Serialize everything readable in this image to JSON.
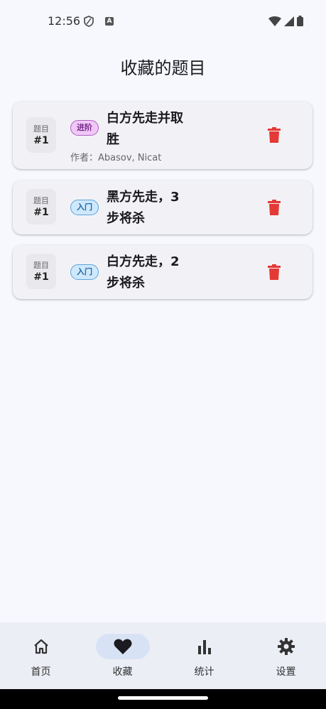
{
  "status": {
    "time": "12:56",
    "a_glyph": "A"
  },
  "page_title": "收藏的题目",
  "favorites": [
    {
      "num_label": "题目",
      "num_value": "#1",
      "level": "进阶",
      "title": "白方先走并取胜",
      "author": "作者：Abasov, Nicat"
    },
    {
      "num_label": "题目",
      "num_value": "#1",
      "level": "入门",
      "title": "黑方先走，3步将杀"
    },
    {
      "num_label": "题目",
      "num_value": "#1",
      "level": "入门",
      "title": "白方先走，2步将杀"
    }
  ],
  "nav": {
    "items": [
      {
        "label": "首页",
        "icon": "home-icon"
      },
      {
        "label": "收藏",
        "icon": "heart-icon"
      },
      {
        "label": "统计",
        "icon": "bar-chart-icon"
      },
      {
        "label": "设置",
        "icon": "gear-icon"
      }
    ],
    "active_index": 1
  },
  "colors": {
    "delete": "#e53935",
    "advanced_badge": "#f0c8f6",
    "beginner_badge": "#cfe8fb",
    "nav_active": "#d7e3f5"
  }
}
